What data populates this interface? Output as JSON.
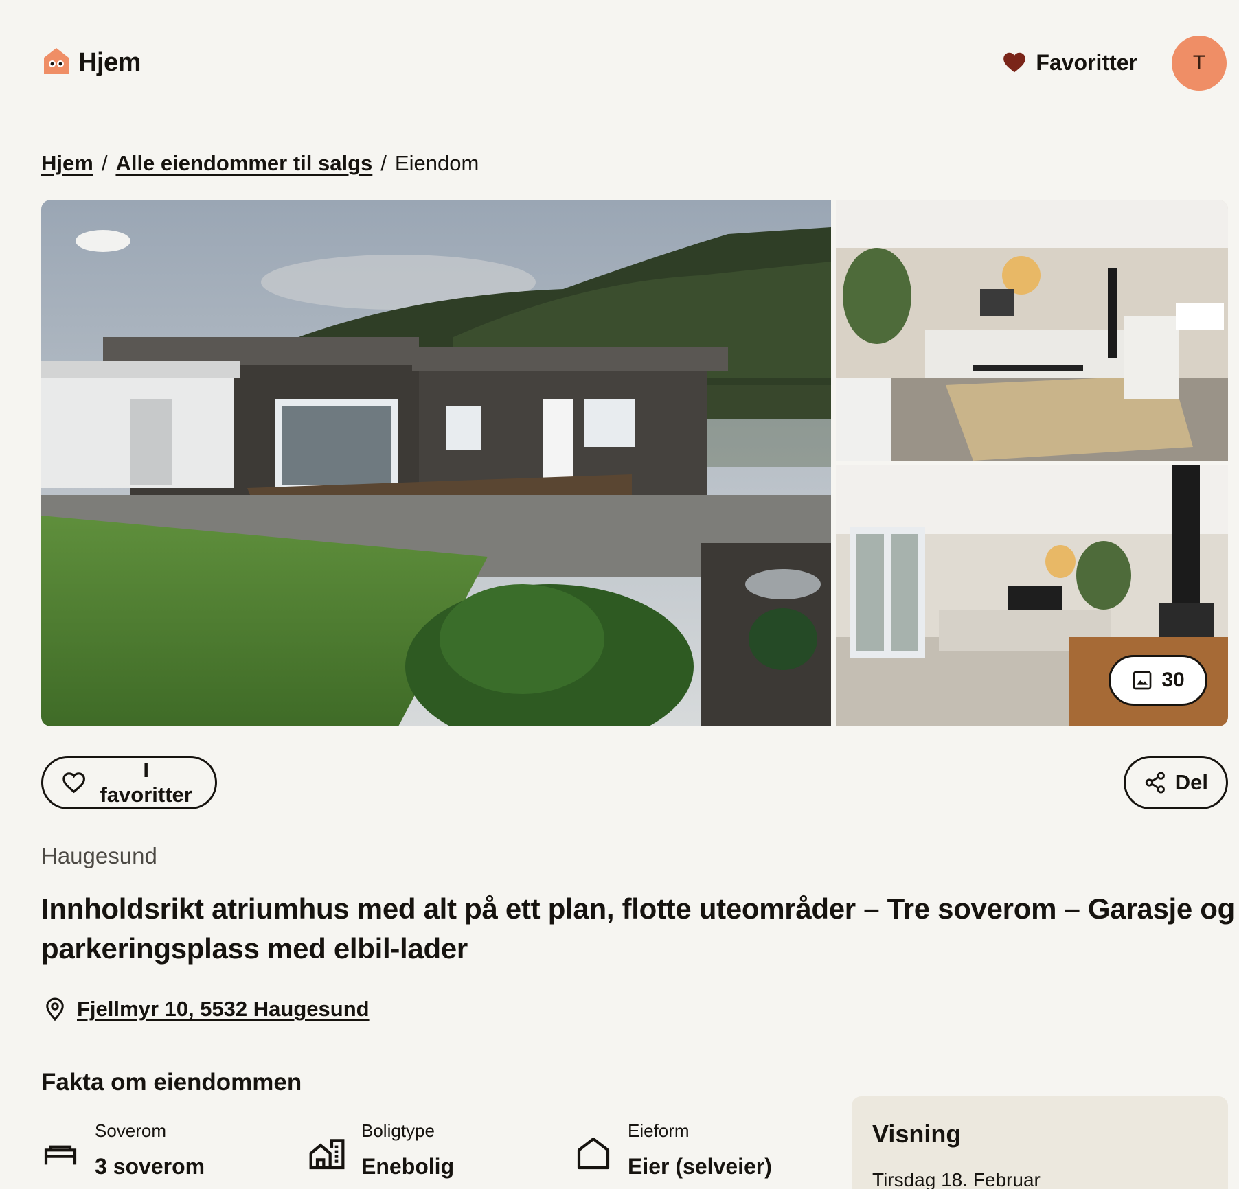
{
  "header": {
    "logo_text": "Hjem",
    "favorites_label": "Favoritter",
    "avatar_initial": "T",
    "accent_color": "#ef8e66",
    "heart_color": "#7a2519"
  },
  "breadcrumb": {
    "home": "Hjem",
    "all_properties": "Alle eiendommer til salgs",
    "current": "Eiendom"
  },
  "gallery": {
    "photo_count": "30",
    "photos": [
      "exterior-atrium-house",
      "living-room-sofa",
      "living-room-fireplace"
    ]
  },
  "actions": {
    "favorite_label": "I favoritter",
    "share_label": "Del"
  },
  "listing": {
    "city": "Haugesund",
    "title": "Innholdsrikt atriumhus med alt på ett plan, flotte uteområder – Tre soverom – Garasje og parkeringsplass med elbil-lader",
    "address": "Fjellmyr 10, 5532 Haugesund"
  },
  "facts": {
    "heading": "Fakta om eiendommen",
    "items": [
      {
        "icon": "bed-icon",
        "label": "Soverom",
        "value": "3 soverom"
      },
      {
        "icon": "building-icon",
        "label": "Boligtype",
        "value": "Enebolig"
      },
      {
        "icon": "house-icon",
        "label": "Eieform",
        "value": "Eier (selveier)"
      }
    ]
  },
  "viewing": {
    "title": "Visning",
    "date": "Tirsdag 18. Februar"
  }
}
